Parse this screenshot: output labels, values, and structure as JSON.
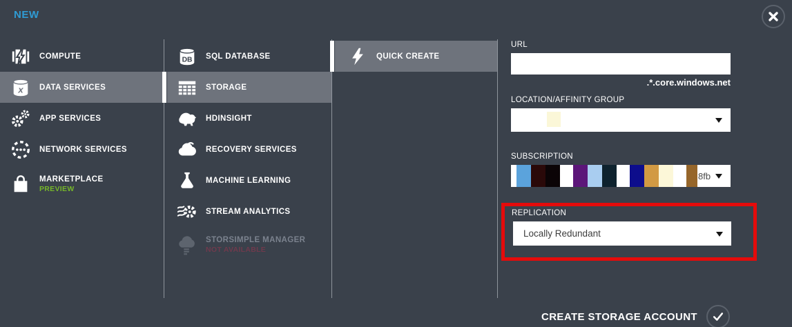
{
  "window": {
    "title": "NEW"
  },
  "colors": {
    "background": "#3a414b",
    "row_highlight": "#6e737c",
    "accent_blue": "#2f9bd4",
    "preview_green": "#76b72a",
    "not_available_red": "#6f3a4d",
    "attention_red": "#e50b0b"
  },
  "nav": {
    "categories": [
      {
        "label": "COMPUTE"
      },
      {
        "label": "DATA SERVICES"
      },
      {
        "label": "APP SERVICES"
      },
      {
        "label": "NETWORK SERVICES"
      },
      {
        "label": "MARKETPLACE",
        "badge": "PREVIEW"
      }
    ],
    "services": [
      {
        "label": "SQL DATABASE"
      },
      {
        "label": "STORAGE"
      },
      {
        "label": "HDINSIGHT"
      },
      {
        "label": "RECOVERY SERVICES"
      },
      {
        "label": "MACHINE LEARNING"
      },
      {
        "label": "STREAM ANALYTICS"
      },
      {
        "label": "STORSIMPLE MANAGER",
        "badge": "NOT AVAILABLE"
      }
    ],
    "create_methods": [
      {
        "label": "QUICK CREATE"
      }
    ]
  },
  "icons": {
    "sql_db_text": "DB",
    "data_services_letter": "x"
  },
  "form": {
    "url": {
      "label": "URL",
      "value": "",
      "suffix": ".*.core.windows.net"
    },
    "location": {
      "label": "LOCATION/AFFINITY GROUP",
      "value": ""
    },
    "subscription": {
      "label": "SUBSCRIPTION",
      "visible_text": "8fb",
      "redaction_blocks": [
        "#5ba3dc",
        "#2a0909",
        "#0b0406",
        "gap",
        "#5c1679",
        "#a9cdf0",
        "#0e222e",
        "gap",
        "#0d0d8c",
        "#d29a43",
        "#fcf7d8",
        "gap",
        "#96662a"
      ]
    },
    "replication": {
      "label": "REPLICATION",
      "value": "Locally Redundant"
    }
  },
  "footer": {
    "submit_label": "CREATE STORAGE ACCOUNT"
  }
}
